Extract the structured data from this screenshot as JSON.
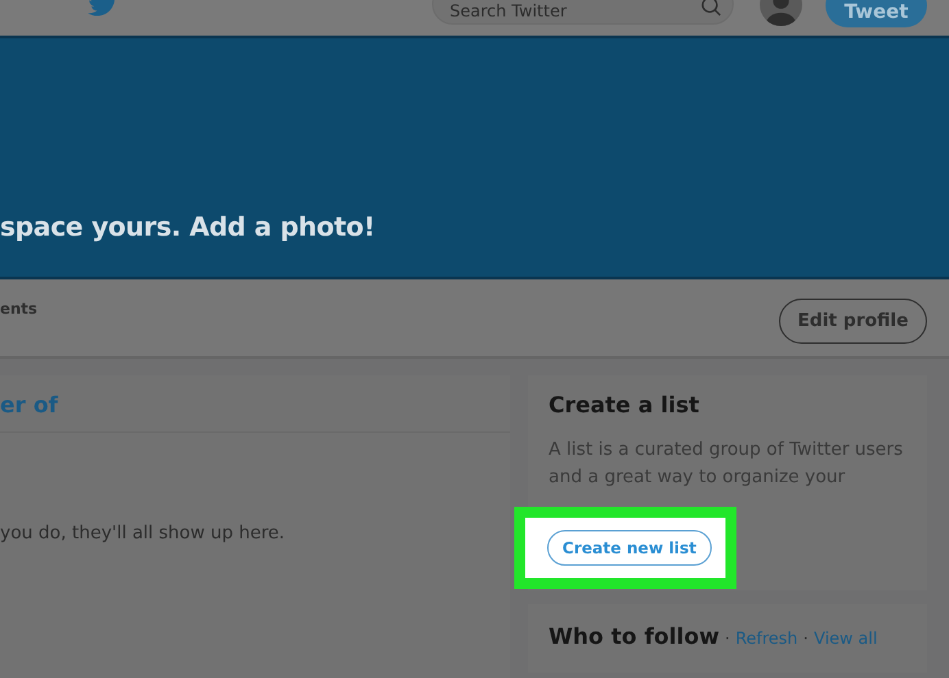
{
  "nav": {
    "search": {
      "placeholder": "Search Twitter"
    },
    "tweet_button": "Tweet"
  },
  "header": {
    "prompt": "space yours. Add a photo!"
  },
  "profile_bar": {
    "stat_label": "ents",
    "edit_button": "Edit profile"
  },
  "member_card": {
    "title": "er of",
    "message": "you do, they'll all show up here."
  },
  "list_card": {
    "title": "Create a list",
    "description": "A list is a curated group of Twitter users and a great way to organize your",
    "button": "Create new list",
    "highlighted": true
  },
  "follow_card": {
    "title": "Who to follow",
    "separator": "·",
    "links": [
      "Refresh",
      "View all"
    ]
  }
}
